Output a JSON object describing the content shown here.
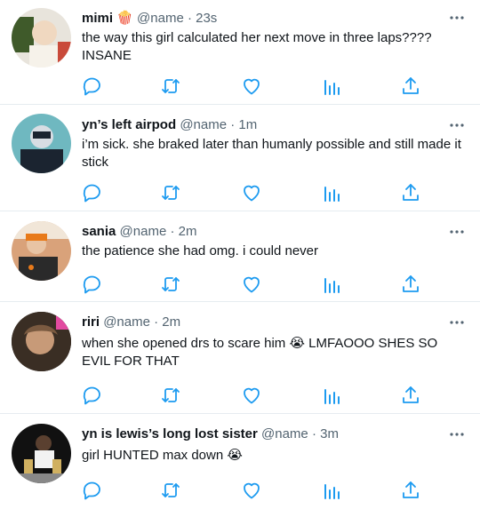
{
  "tweets": [
    {
      "name": "mimi 🍿",
      "handle": "@name",
      "time": "23s",
      "text": "the way this girl calculated her next move in three laps???? INSANE",
      "avatar_colors": [
        "#3f5a2a",
        "#f0d8c0",
        "#c94a3a"
      ]
    },
    {
      "name": "yn’s left airpod",
      "handle": "@name",
      "time": "1m",
      "text": "i’m sick. she braked later than humanly possible and still made it stick",
      "avatar_colors": [
        "#6fb8c0",
        "#1b2430",
        "#d8dde3"
      ]
    },
    {
      "name": "sania",
      "handle": "@name",
      "time": "2m",
      "text": "the patience she had omg. i could never",
      "avatar_colors": [
        "#d9a27a",
        "#e87a1a",
        "#2a2a2a"
      ]
    },
    {
      "name": "riri",
      "handle": "@name",
      "time": "2m",
      "text": "when she opened drs to scare him 😭 LMFAOOO SHES SO EVIL FOR THAT",
      "avatar_colors": [
        "#2b231c",
        "#c79a78",
        "#7a5a40"
      ]
    },
    {
      "name": "yn is lewis’s long lost sister",
      "handle": "@name",
      "time": "3m",
      "text": "girl HUNTED max down 😭",
      "avatar_colors": [
        "#111111",
        "#d0b060",
        "#888888"
      ]
    }
  ],
  "separator": "·",
  "icons": [
    "reply-icon",
    "retweet-icon",
    "like-icon",
    "views-icon",
    "share-icon",
    "more-icon"
  ],
  "colors": {
    "icon": "#1d9bf0",
    "name": "#0f1419",
    "meta": "#536471",
    "divider": "#e6ecf0"
  }
}
